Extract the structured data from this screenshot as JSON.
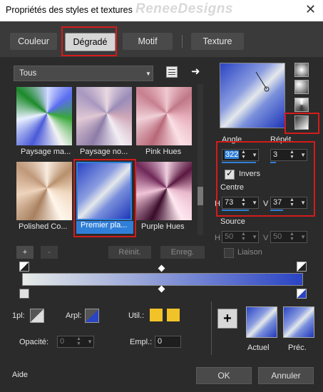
{
  "window": {
    "title": "Propriétés des styles et textures",
    "watermark": "ReneeDesigns",
    "close_glyph": "✕"
  },
  "tabs": [
    {
      "label": "Couleur"
    },
    {
      "label": "Dégradé"
    },
    {
      "label": "Motif"
    },
    {
      "label": "Texture"
    }
  ],
  "library": {
    "category": "Tous",
    "items": [
      {
        "label": "Paysage ma..."
      },
      {
        "label": "Paysage no..."
      },
      {
        "label": "Pink Hues"
      },
      {
        "label": "Polished Co..."
      },
      {
        "label": "Premier pla..."
      },
      {
        "label": "Purple Hues"
      }
    ],
    "selected": "Premier pla..."
  },
  "params": {
    "angle_label": "Angle",
    "angle_value": "322",
    "repeat_label": "Répét.",
    "repeat_value": "3",
    "invert_label": "Invers",
    "center_label": "Centre",
    "h_label": "H",
    "v_label": "V",
    "center_h": "73",
    "center_v": "37",
    "source_label": "Source",
    "source_h": "50",
    "source_v": "50",
    "link_label": "Liaison"
  },
  "editor_buttons": {
    "add": "+",
    "remove": "-",
    "reset": "Réinit.",
    "save": "Enreg."
  },
  "bottom": {
    "fg_label": "1pl:",
    "bg_label": "Arpl:",
    "util_label": "Util.:",
    "opacity_label": "Opacité:",
    "opacity_value": "0",
    "position_label": "Empl.:",
    "position_value": "0",
    "current_label": "Actuel",
    "previous_label": "Préc.",
    "add_glyph": "+"
  },
  "footer": {
    "help": "Aide",
    "ok": "OK",
    "cancel": "Annuler"
  },
  "colors": {
    "accent_red": "#d41b1b",
    "selection_blue": "#2f7fd8",
    "util_yellow": "#f2c229"
  }
}
